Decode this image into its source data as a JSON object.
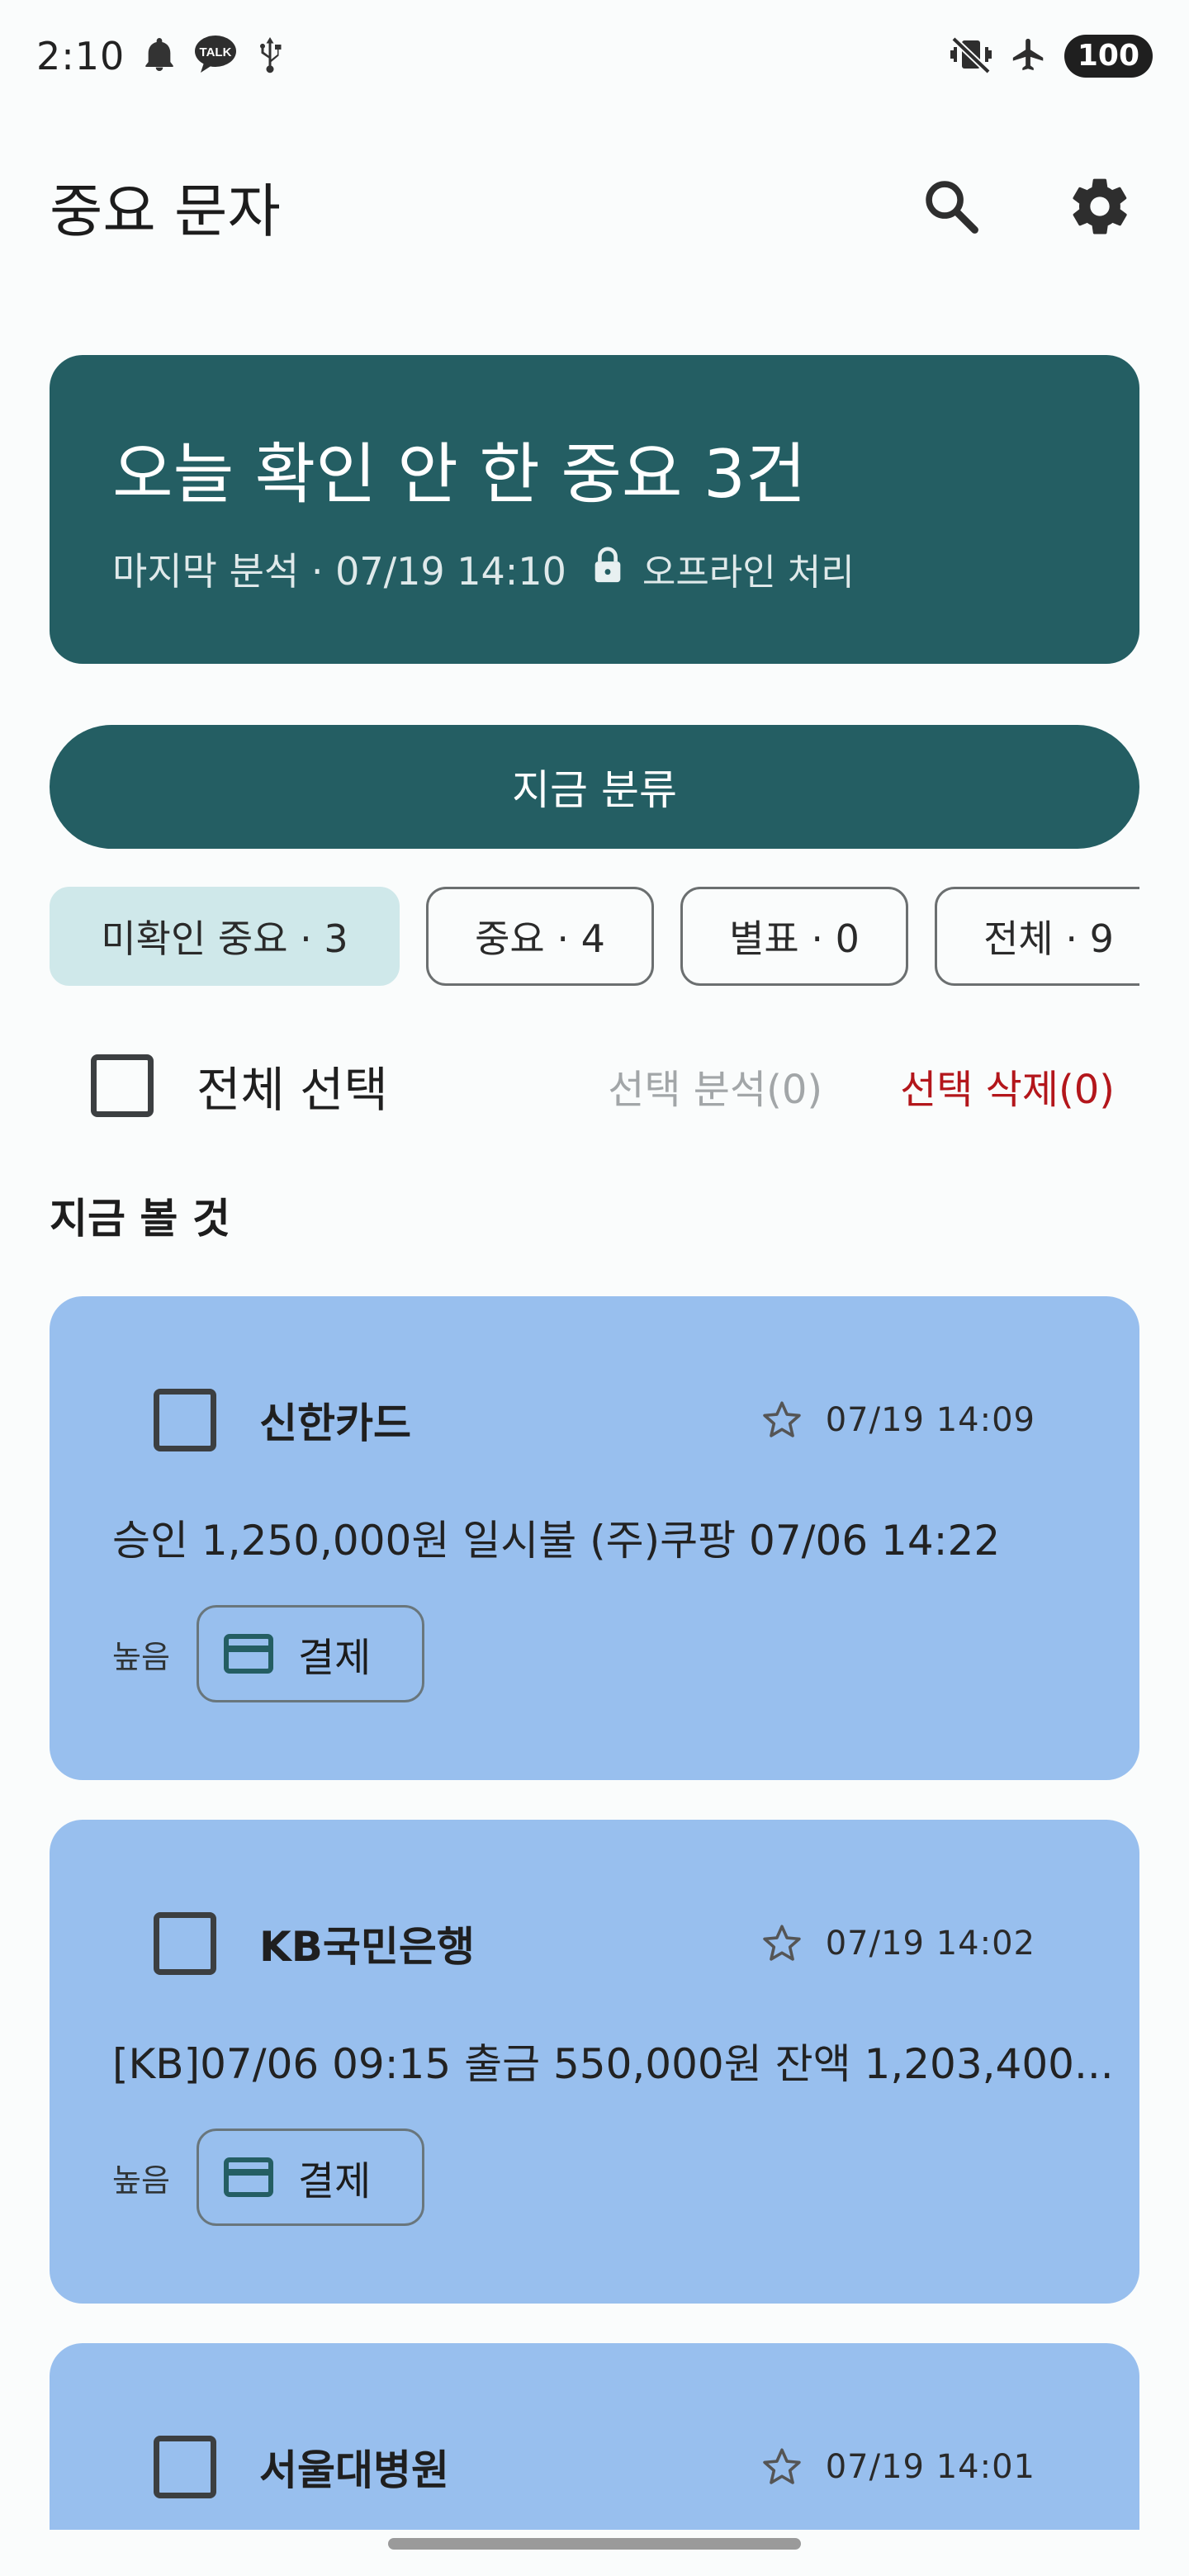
{
  "status": {
    "time": "2:10",
    "battery": "100",
    "talk_badge": "TALK",
    "left_icons": [
      "bell-icon",
      "talk-icon",
      "usb-icon"
    ],
    "right_icons": [
      "vibrate-off-icon",
      "airplane-icon"
    ]
  },
  "appbar": {
    "title": "중요 문자",
    "icons": [
      "search-icon",
      "gear-icon"
    ]
  },
  "summary": {
    "headline": "오늘 확인 안 한 중요 3건",
    "last_analysis": "마지막 분석 · 07/19 14:10",
    "offline": "오프라인 처리"
  },
  "classify_button": "지금 분류",
  "chips": [
    {
      "label": "미확인 중요 · 3",
      "active": true
    },
    {
      "label": "중요 · 4",
      "active": false
    },
    {
      "label": "별표 · 0",
      "active": false
    },
    {
      "label": "전체 · 9",
      "active": false
    }
  ],
  "selection": {
    "select_all": "전체 선택",
    "analyze_selected": "선택 분석(0)",
    "delete_selected": "선택 삭제(0)"
  },
  "section_title": "지금 볼 것",
  "messages": [
    {
      "sender": "신한카드",
      "time": "07/19 14:09",
      "body": "승인 1,250,000원 일시불 (주)쿠팡 07/06 14:22",
      "priority": "높음",
      "tag": "결제"
    },
    {
      "sender": "KB국민은행",
      "time": "07/19 14:02",
      "body": "[KB]07/06 09:15 출금 550,000원 잔액 1,203,400...",
      "priority": "높음",
      "tag": "결제"
    },
    {
      "sender": "서울대병원",
      "time": "07/19 14:01",
      "body": "",
      "priority": "",
      "tag": ""
    }
  ],
  "colors": {
    "primary": "#245e63",
    "card": "#98bfee",
    "chip_active": "#cfe8ea",
    "danger": "#b3161b"
  }
}
